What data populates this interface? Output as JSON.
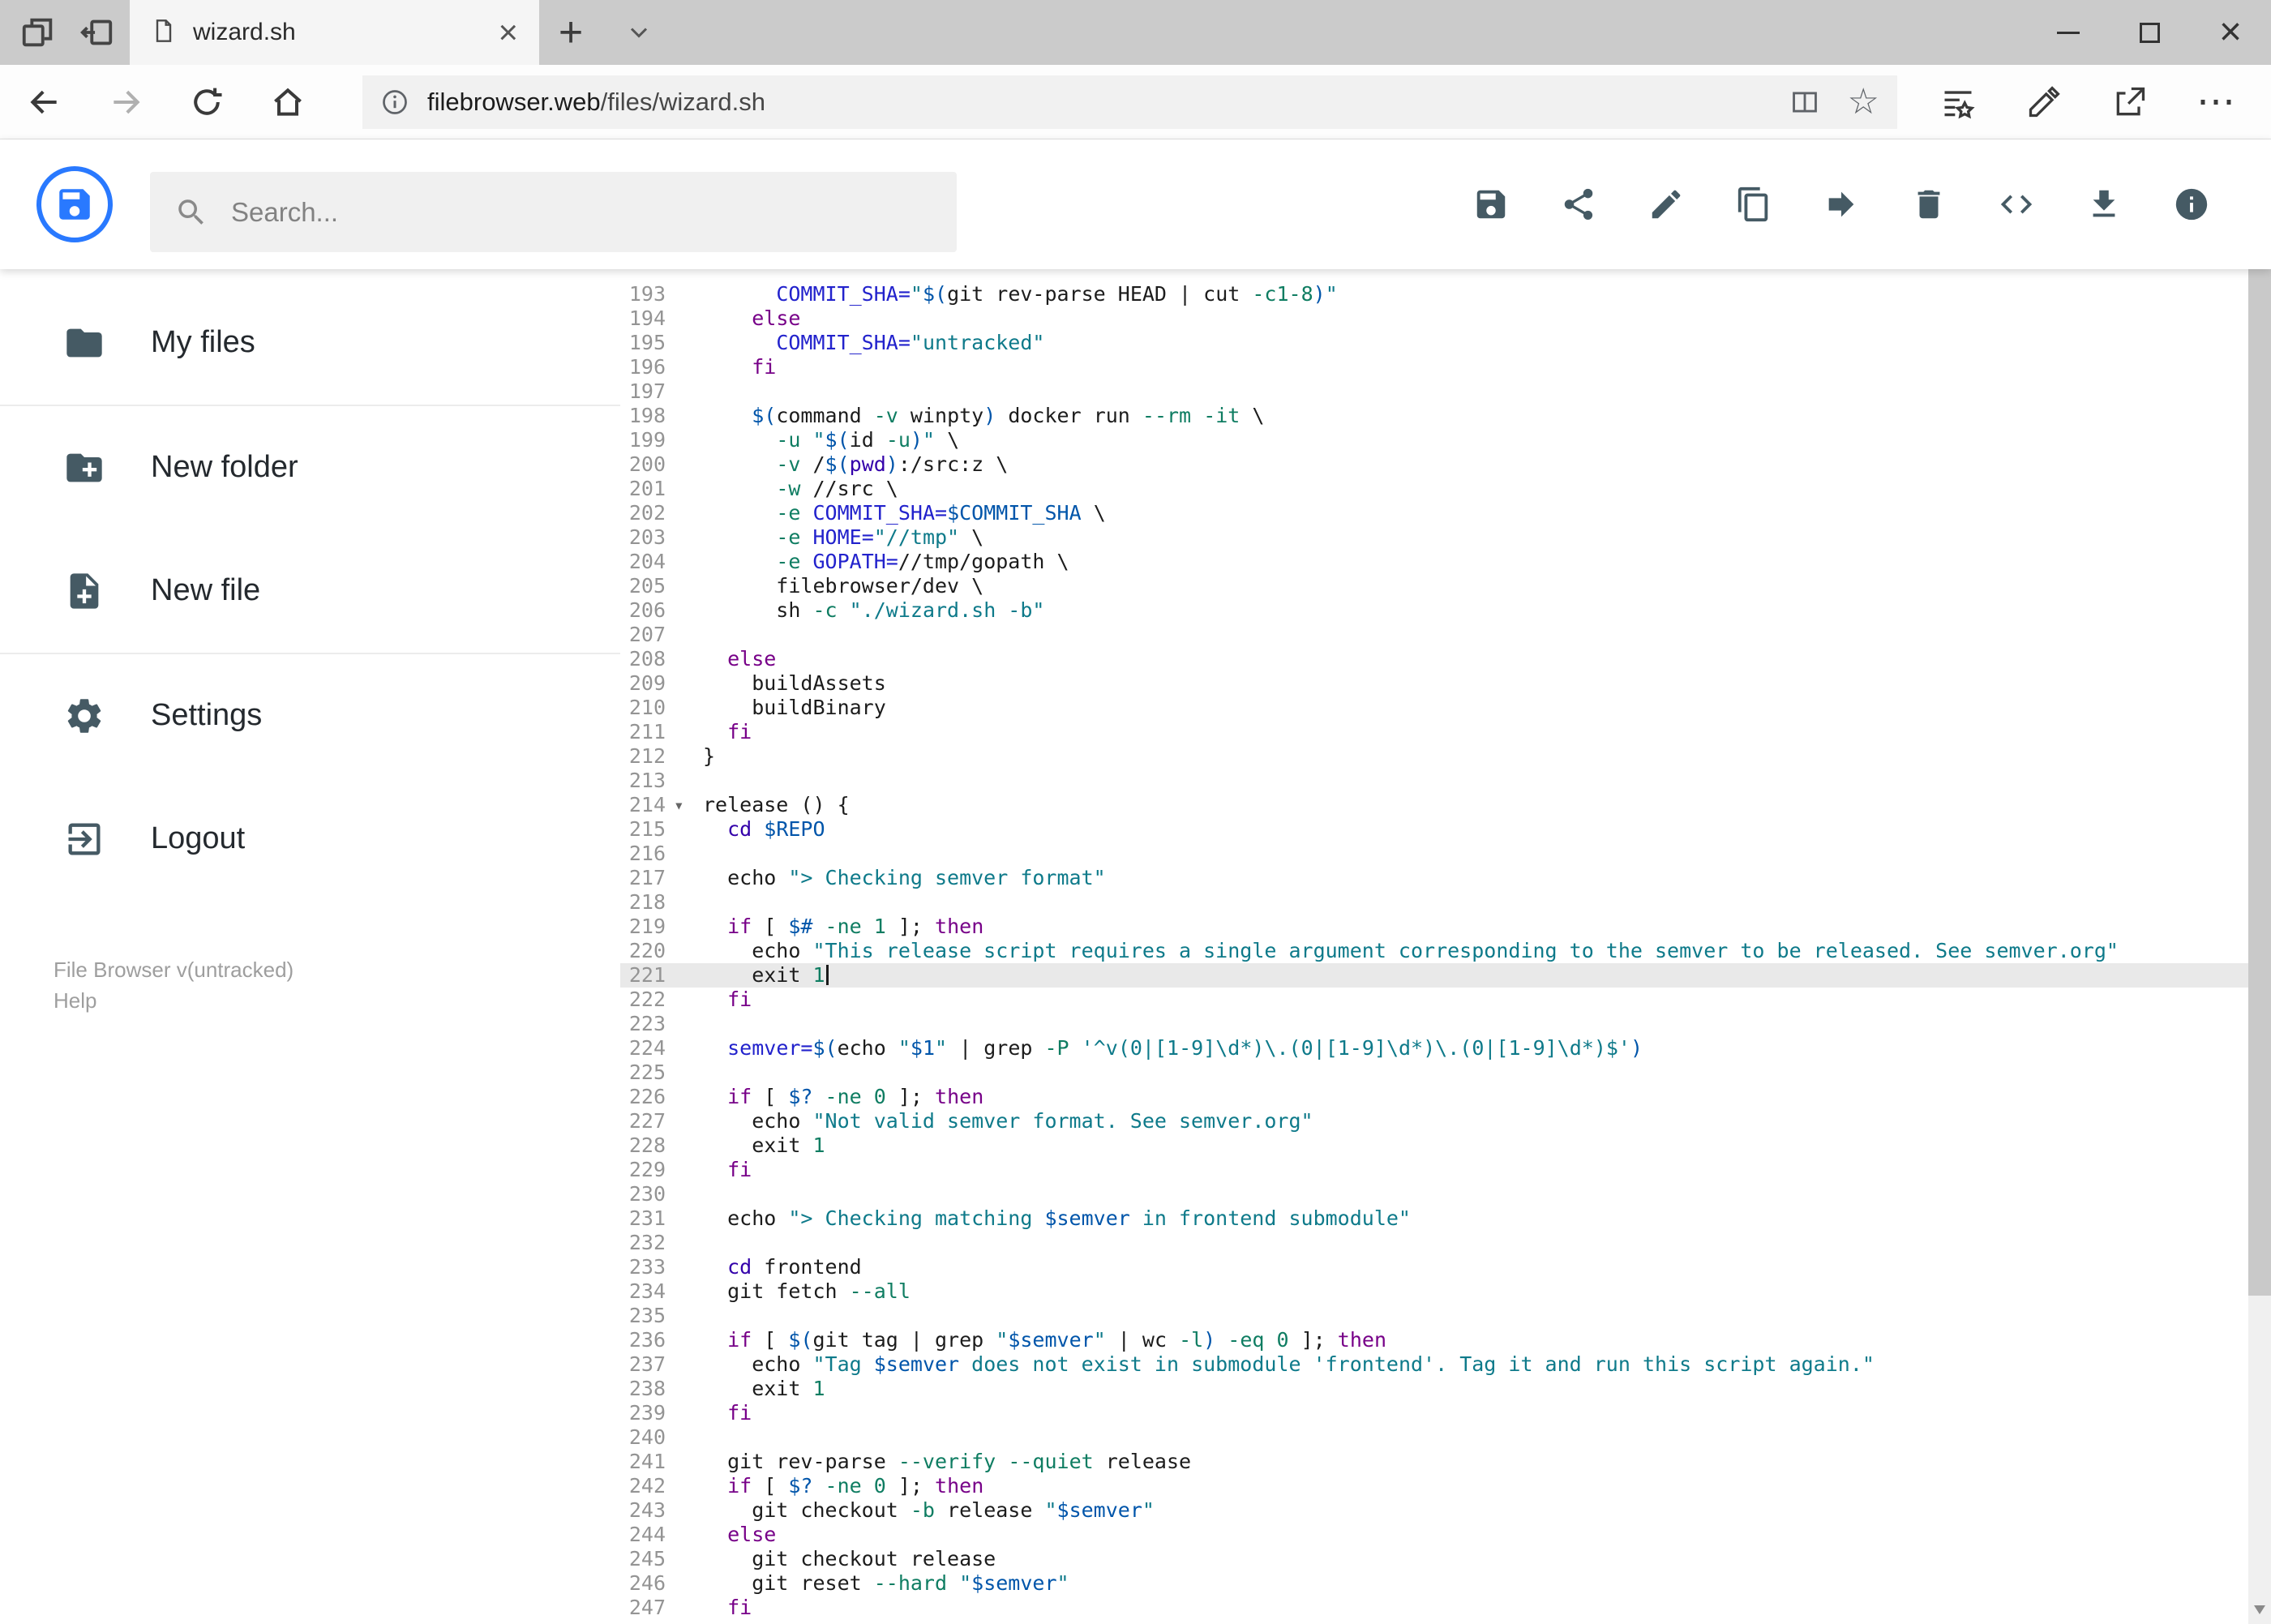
{
  "browser": {
    "tab_title": "wizard.sh",
    "url": {
      "domain": "filebrowser.web",
      "path": "/files/wizard.sh"
    },
    "nav_icons": [
      "back",
      "forward",
      "refresh",
      "home"
    ],
    "address_icons": [
      "info",
      "reading-view",
      "favorite-star"
    ],
    "toolbar_icons": [
      "hub",
      "web-note",
      "share",
      "more"
    ],
    "tab_icons": [
      "tab-preview",
      "set-tabs-aside",
      "page",
      "close-tab",
      "new-tab",
      "tab-chevron"
    ],
    "window_controls": [
      "minimize",
      "maximize",
      "close"
    ]
  },
  "header": {
    "search_placeholder": "Search...",
    "logo_icon": "floppy-disk",
    "action_icons": [
      "save",
      "share",
      "rename",
      "copy",
      "move",
      "delete",
      "code",
      "download",
      "info"
    ],
    "accent_color": "#2979ff",
    "icon_color": "#455a64"
  },
  "sidebar": {
    "items": [
      {
        "label": "My files",
        "icon": "folder"
      },
      {
        "label": "New folder",
        "icon": "create-new-folder"
      },
      {
        "label": "New file",
        "icon": "new-file"
      },
      {
        "label": "Settings",
        "icon": "settings-gear"
      },
      {
        "label": "Logout",
        "icon": "logout"
      }
    ],
    "footer": {
      "version": "File Browser v(untracked)",
      "help": "Help"
    }
  },
  "editor": {
    "language": "shell",
    "first_line": 193,
    "last_line": 247,
    "active_line": 221,
    "cursor_line": 221,
    "fold_markers": [
      214
    ],
    "token_colors": {
      "plain": "#1c1c1c",
      "keyword": "#770088",
      "string": "#0e7a8a",
      "variable": "#0055aa",
      "definition": "#2222cc",
      "number": "#0f7d62",
      "builtin": "#3300aa"
    },
    "lines": [
      {
        "n": 193,
        "t": [
          [
            "p",
            "      "
          ],
          [
            "d",
            "COMMIT_SHA="
          ],
          [
            "s",
            "\""
          ],
          [
            "v",
            "$("
          ],
          [
            "p",
            "git rev-parse HEAD | cut "
          ],
          [
            "n",
            "-c1-8"
          ],
          [
            "v",
            ")"
          ],
          [
            "s",
            "\""
          ]
        ]
      },
      {
        "n": 194,
        "t": [
          [
            "p",
            "    "
          ],
          [
            "k",
            "else"
          ]
        ]
      },
      {
        "n": 195,
        "t": [
          [
            "p",
            "      "
          ],
          [
            "d",
            "COMMIT_SHA="
          ],
          [
            "s",
            "\"untracked\""
          ]
        ]
      },
      {
        "n": 196,
        "t": [
          [
            "p",
            "    "
          ],
          [
            "k",
            "fi"
          ]
        ]
      },
      {
        "n": 197,
        "t": []
      },
      {
        "n": 198,
        "t": [
          [
            "p",
            "    "
          ],
          [
            "v",
            "$("
          ],
          [
            "p",
            "command "
          ],
          [
            "n",
            "-v"
          ],
          [
            "p",
            " winpty"
          ],
          [
            "v",
            ")"
          ],
          [
            "p",
            " docker run "
          ],
          [
            "n",
            "--rm"
          ],
          [
            "p",
            " "
          ],
          [
            "n",
            "-it"
          ],
          [
            "p",
            " \\"
          ]
        ]
      },
      {
        "n": 199,
        "t": [
          [
            "p",
            "      "
          ],
          [
            "n",
            "-u"
          ],
          [
            "p",
            " "
          ],
          [
            "s",
            "\""
          ],
          [
            "v",
            "$("
          ],
          [
            "p",
            "id "
          ],
          [
            "n",
            "-u"
          ],
          [
            "v",
            ")"
          ],
          [
            "s",
            "\""
          ],
          [
            "p",
            " \\"
          ]
        ]
      },
      {
        "n": 200,
        "t": [
          [
            "p",
            "      "
          ],
          [
            "n",
            "-v"
          ],
          [
            "p",
            " /"
          ],
          [
            "v",
            "$("
          ],
          [
            "b",
            "pwd"
          ],
          [
            "v",
            ")"
          ],
          [
            "p",
            ":/src:z \\"
          ]
        ]
      },
      {
        "n": 201,
        "t": [
          [
            "p",
            "      "
          ],
          [
            "n",
            "-w"
          ],
          [
            "p",
            " //src \\"
          ]
        ]
      },
      {
        "n": 202,
        "t": [
          [
            "p",
            "      "
          ],
          [
            "n",
            "-e"
          ],
          [
            "p",
            " "
          ],
          [
            "d",
            "COMMIT_SHA="
          ],
          [
            "v",
            "$COMMIT_SHA"
          ],
          [
            "p",
            " \\"
          ]
        ]
      },
      {
        "n": 203,
        "t": [
          [
            "p",
            "      "
          ],
          [
            "n",
            "-e"
          ],
          [
            "p",
            " "
          ],
          [
            "d",
            "HOME="
          ],
          [
            "s",
            "\"//tmp\""
          ],
          [
            "p",
            " \\"
          ]
        ]
      },
      {
        "n": 204,
        "t": [
          [
            "p",
            "      "
          ],
          [
            "n",
            "-e"
          ],
          [
            "p",
            " "
          ],
          [
            "d",
            "GOPATH="
          ],
          [
            "p",
            "//tmp/gopath \\"
          ]
        ]
      },
      {
        "n": 205,
        "t": [
          [
            "p",
            "      filebrowser/dev \\"
          ]
        ]
      },
      {
        "n": 206,
        "t": [
          [
            "p",
            "      sh "
          ],
          [
            "n",
            "-c"
          ],
          [
            "p",
            " "
          ],
          [
            "s",
            "\"./wizard.sh -b\""
          ]
        ]
      },
      {
        "n": 207,
        "t": []
      },
      {
        "n": 208,
        "t": [
          [
            "p",
            "  "
          ],
          [
            "k",
            "else"
          ]
        ]
      },
      {
        "n": 209,
        "t": [
          [
            "p",
            "    buildAssets"
          ]
        ]
      },
      {
        "n": 210,
        "t": [
          [
            "p",
            "    buildBinary"
          ]
        ]
      },
      {
        "n": 211,
        "t": [
          [
            "p",
            "  "
          ],
          [
            "k",
            "fi"
          ]
        ]
      },
      {
        "n": 212,
        "t": [
          [
            "p",
            "}"
          ]
        ]
      },
      {
        "n": 213,
        "t": []
      },
      {
        "n": 214,
        "t": [
          [
            "p",
            "release () {"
          ]
        ]
      },
      {
        "n": 215,
        "t": [
          [
            "p",
            "  "
          ],
          [
            "b",
            "cd"
          ],
          [
            "p",
            " "
          ],
          [
            "v",
            "$REPO"
          ]
        ]
      },
      {
        "n": 216,
        "t": []
      },
      {
        "n": 217,
        "t": [
          [
            "p",
            "  echo "
          ],
          [
            "s",
            "\"> Checking semver format\""
          ]
        ]
      },
      {
        "n": 218,
        "t": []
      },
      {
        "n": 219,
        "t": [
          [
            "p",
            "  "
          ],
          [
            "k",
            "if"
          ],
          [
            "p",
            " [ "
          ],
          [
            "v",
            "$#"
          ],
          [
            "p",
            " "
          ],
          [
            "n",
            "-ne"
          ],
          [
            "p",
            " "
          ],
          [
            "n",
            "1"
          ],
          [
            "p",
            " ]; "
          ],
          [
            "k",
            "then"
          ]
        ]
      },
      {
        "n": 220,
        "t": [
          [
            "p",
            "    echo "
          ],
          [
            "s",
            "\"This release script requires a single argument corresponding to the semver to be released. See semver.org\""
          ]
        ]
      },
      {
        "n": 221,
        "t": [
          [
            "p",
            "    exit "
          ],
          [
            "n",
            "1"
          ]
        ]
      },
      {
        "n": 222,
        "t": [
          [
            "p",
            "  "
          ],
          [
            "k",
            "fi"
          ]
        ]
      },
      {
        "n": 223,
        "t": []
      },
      {
        "n": 224,
        "t": [
          [
            "p",
            "  "
          ],
          [
            "d",
            "semver="
          ],
          [
            "v",
            "$("
          ],
          [
            "p",
            "echo "
          ],
          [
            "s",
            "\""
          ],
          [
            "v",
            "$1"
          ],
          [
            "s",
            "\""
          ],
          [
            "p",
            " | grep "
          ],
          [
            "n",
            "-P"
          ],
          [
            "p",
            " "
          ],
          [
            "s",
            "'^v(0|[1-9]\\d*)\\.(0|[1-9]\\d*)\\.(0|[1-9]\\d*)$'"
          ],
          [
            "v",
            ")"
          ]
        ]
      },
      {
        "n": 225,
        "t": []
      },
      {
        "n": 226,
        "t": [
          [
            "p",
            "  "
          ],
          [
            "k",
            "if"
          ],
          [
            "p",
            " [ "
          ],
          [
            "v",
            "$?"
          ],
          [
            "p",
            " "
          ],
          [
            "n",
            "-ne"
          ],
          [
            "p",
            " "
          ],
          [
            "n",
            "0"
          ],
          [
            "p",
            " ]; "
          ],
          [
            "k",
            "then"
          ]
        ]
      },
      {
        "n": 227,
        "t": [
          [
            "p",
            "    echo "
          ],
          [
            "s",
            "\"Not valid semver format. See semver.org\""
          ]
        ]
      },
      {
        "n": 228,
        "t": [
          [
            "p",
            "    exit "
          ],
          [
            "n",
            "1"
          ]
        ]
      },
      {
        "n": 229,
        "t": [
          [
            "p",
            "  "
          ],
          [
            "k",
            "fi"
          ]
        ]
      },
      {
        "n": 230,
        "t": []
      },
      {
        "n": 231,
        "t": [
          [
            "p",
            "  echo "
          ],
          [
            "s",
            "\"> Checking matching "
          ],
          [
            "v",
            "$semver"
          ],
          [
            "s",
            " in frontend submodule\""
          ]
        ]
      },
      {
        "n": 232,
        "t": []
      },
      {
        "n": 233,
        "t": [
          [
            "p",
            "  "
          ],
          [
            "b",
            "cd"
          ],
          [
            "p",
            " frontend"
          ]
        ]
      },
      {
        "n": 234,
        "t": [
          [
            "p",
            "  git fetch "
          ],
          [
            "n",
            "--all"
          ]
        ]
      },
      {
        "n": 235,
        "t": []
      },
      {
        "n": 236,
        "t": [
          [
            "p",
            "  "
          ],
          [
            "k",
            "if"
          ],
          [
            "p",
            " [ "
          ],
          [
            "v",
            "$("
          ],
          [
            "p",
            "git tag | grep "
          ],
          [
            "s",
            "\""
          ],
          [
            "v",
            "$semver"
          ],
          [
            "s",
            "\""
          ],
          [
            "p",
            " | wc "
          ],
          [
            "n",
            "-l"
          ],
          [
            "v",
            ")"
          ],
          [
            "p",
            " "
          ],
          [
            "n",
            "-eq"
          ],
          [
            "p",
            " "
          ],
          [
            "n",
            "0"
          ],
          [
            "p",
            " ]; "
          ],
          [
            "k",
            "then"
          ]
        ]
      },
      {
        "n": 237,
        "t": [
          [
            "p",
            "    echo "
          ],
          [
            "s",
            "\"Tag "
          ],
          [
            "v",
            "$semver"
          ],
          [
            "s",
            " does not exist in submodule 'frontend'. Tag it and run this script again.\""
          ]
        ]
      },
      {
        "n": 238,
        "t": [
          [
            "p",
            "    exit "
          ],
          [
            "n",
            "1"
          ]
        ]
      },
      {
        "n": 239,
        "t": [
          [
            "p",
            "  "
          ],
          [
            "k",
            "fi"
          ]
        ]
      },
      {
        "n": 240,
        "t": []
      },
      {
        "n": 241,
        "t": [
          [
            "p",
            "  git rev-parse "
          ],
          [
            "n",
            "--verify"
          ],
          [
            "p",
            " "
          ],
          [
            "n",
            "--quiet"
          ],
          [
            "p",
            " release"
          ]
        ]
      },
      {
        "n": 242,
        "t": [
          [
            "p",
            "  "
          ],
          [
            "k",
            "if"
          ],
          [
            "p",
            " [ "
          ],
          [
            "v",
            "$?"
          ],
          [
            "p",
            " "
          ],
          [
            "n",
            "-ne"
          ],
          [
            "p",
            " "
          ],
          [
            "n",
            "0"
          ],
          [
            "p",
            " ]; "
          ],
          [
            "k",
            "then"
          ]
        ]
      },
      {
        "n": 243,
        "t": [
          [
            "p",
            "    git checkout "
          ],
          [
            "n",
            "-b"
          ],
          [
            "p",
            " release "
          ],
          [
            "s",
            "\""
          ],
          [
            "v",
            "$semver"
          ],
          [
            "s",
            "\""
          ]
        ]
      },
      {
        "n": 244,
        "t": [
          [
            "p",
            "  "
          ],
          [
            "k",
            "else"
          ]
        ]
      },
      {
        "n": 245,
        "t": [
          [
            "p",
            "    git checkout release"
          ]
        ]
      },
      {
        "n": 246,
        "t": [
          [
            "p",
            "    git reset "
          ],
          [
            "n",
            "--hard"
          ],
          [
            "p",
            " "
          ],
          [
            "s",
            "\""
          ],
          [
            "v",
            "$semver"
          ],
          [
            "s",
            "\""
          ]
        ]
      },
      {
        "n": 247,
        "t": [
          [
            "p",
            "  "
          ],
          [
            "k",
            "fi"
          ]
        ]
      }
    ]
  }
}
